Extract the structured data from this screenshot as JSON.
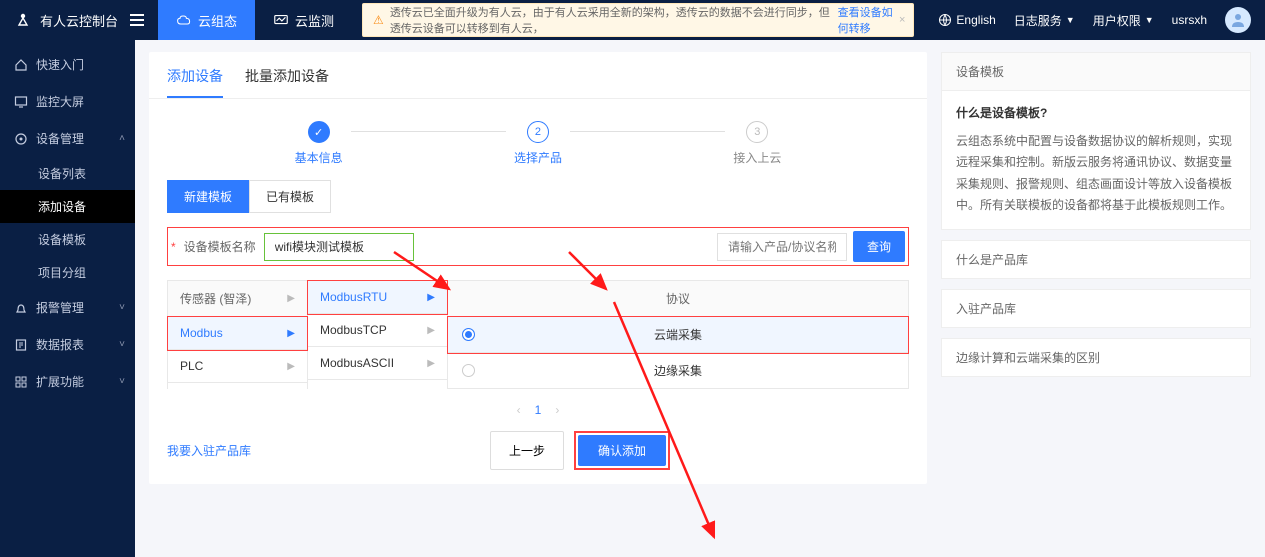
{
  "brand": "有人云控制台",
  "topnav": {
    "cloud_config": "云组态",
    "cloud_monitor": "云监测"
  },
  "notice": {
    "text": "透传云已全面升级为有人云，由于有人云采用全新的架构，透传云的数据不会进行同步，但透传云设备可以转移到有人云，",
    "link": "查看设备如何转移"
  },
  "topright": {
    "lang": "English",
    "log_service": "日志服务",
    "user_perm": "用户权限",
    "username": "usrsxh"
  },
  "sidebar": {
    "quickstart": "快速入门",
    "bigscreen": "监控大屏",
    "device_mgmt": "设备管理",
    "device_list": "设备列表",
    "add_device": "添加设备",
    "device_tpl": "设备模板",
    "project_group": "项目分组",
    "alarm_mgmt": "报警管理",
    "data_report": "数据报表",
    "extend": "扩展功能"
  },
  "tabs": {
    "add_single": "添加设备",
    "add_batch": "批量添加设备"
  },
  "steps": {
    "s1": "基本信息",
    "s2": "选择产品",
    "s3": "接入上云"
  },
  "subtabs": {
    "new_tpl": "新建模板",
    "exist_tpl": "已有模板"
  },
  "form": {
    "name_label": "设备模板名称",
    "name_value": "wifi模块测试模板",
    "search_placeholder": "请输入产品/协议名称",
    "search_btn": "查询"
  },
  "grid": {
    "col1_header": "传感器 (智泽)",
    "col1_items": [
      "Modbus",
      "PLC"
    ],
    "col2_items": [
      "ModbusRTU",
      "ModbusTCP",
      "ModbusASCII"
    ],
    "proto_header": "协议",
    "proto_options": [
      "云端采集",
      "边缘采集"
    ]
  },
  "pagination": {
    "page": "1"
  },
  "footer": {
    "link": "我要入驻产品库",
    "prev": "上一步",
    "confirm": "确认添加"
  },
  "right": {
    "panel_title": "设备模板",
    "q1": "什么是设备模板?",
    "a1": "云组态系统中配置与设备数据协议的解析规则，实现远程采集和控制。新版云服务将通讯协议、数据变量采集规则、报警规则、组态画面设计等放入设备模板中。所有关联模板的设备都将基于此模板规则工作。",
    "q2": "什么是产品库",
    "q3": "入驻产品库",
    "q4": "边缘计算和云端采集的区别"
  }
}
